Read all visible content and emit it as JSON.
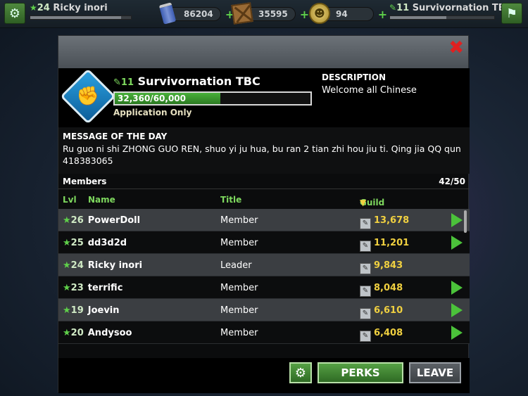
{
  "topbar": {
    "player": {
      "level": "24",
      "name": "Ricky inori",
      "progress": 0.9
    },
    "resources": [
      {
        "icon": "soda-can-icon",
        "value": "86204"
      },
      {
        "icon": "supply-crate-icon",
        "value": "35595"
      },
      {
        "icon": "gold-coin-icon",
        "value": "94"
      }
    ],
    "guild": {
      "level": "11",
      "name": "Survivornation TBC",
      "progress": 0.54
    }
  },
  "guild": {
    "level": "11",
    "name": "Survivornation TBC",
    "xp_text": "32,360/60,000",
    "xp_fraction": 0.5393,
    "join_mode": "Application Only",
    "description_title": "DESCRIPTION",
    "description": "Welcome all Chinese",
    "motd_title": "MESSAGE OF THE DAY",
    "motd": "Ru guo ni shi ZHONG GUO REN, shuo yi ju hua, bu ran 2 tian zhi hou jiu ti. Qing jia QQ qun 418383065",
    "members_label": "Members",
    "members_count": "42/50"
  },
  "columns": {
    "lvl": "Lvl",
    "name": "Name",
    "title": "Title",
    "xp": "Guild XP"
  },
  "members": [
    {
      "level": "26",
      "name": "PowerDoll",
      "title": "Member",
      "xp": "13,678",
      "shade": "light",
      "action": true
    },
    {
      "level": "25",
      "name": "dd3d2d",
      "title": "Member",
      "xp": "11,201",
      "shade": "dark",
      "action": true
    },
    {
      "level": "24",
      "name": "Ricky inori",
      "title": "Leader",
      "xp": "9,843",
      "shade": "light",
      "action": false
    },
    {
      "level": "23",
      "name": "terrific",
      "title": "Member",
      "xp": "8,048",
      "shade": "dark",
      "action": true
    },
    {
      "level": "19",
      "name": "Joevin",
      "title": "Member",
      "xp": "6,610",
      "shade": "light",
      "action": true
    },
    {
      "level": "20",
      "name": "Andysoo",
      "title": "Member",
      "xp": "6,408",
      "shade": "dark",
      "action": true
    }
  ],
  "footer": {
    "perks_label": "PERKS",
    "leave_label": "LEAVE"
  },
  "colors": {
    "accent_green": "#4bc23a",
    "xp_gold": "#f0d040",
    "close_red": "#e02020"
  }
}
